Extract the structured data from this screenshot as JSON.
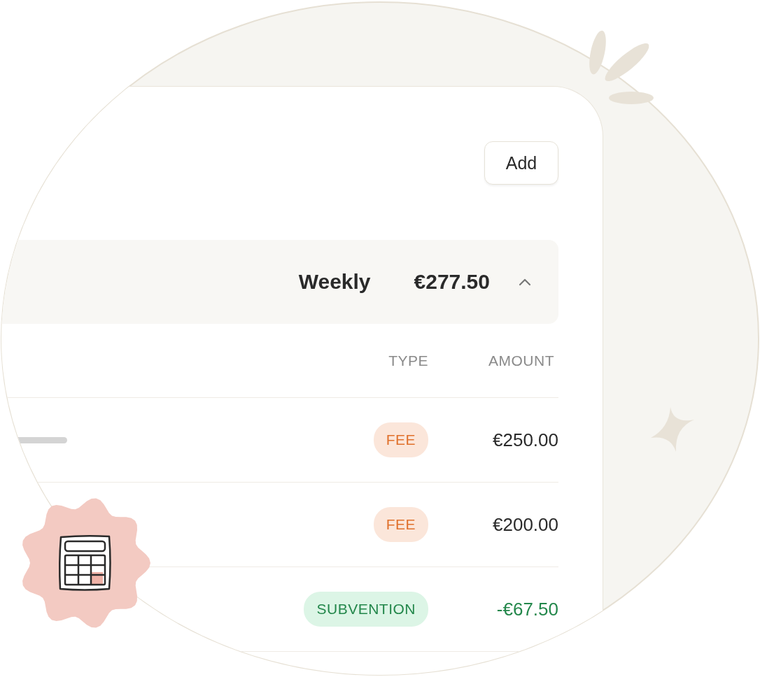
{
  "toolbar": {
    "add_button": "Add"
  },
  "summary": {
    "period": "Weekly",
    "total": "€277.50",
    "expanded": true
  },
  "table": {
    "columns": [
      "TYPE",
      "AMOUNT"
    ],
    "rows": [
      {
        "kind": "fee",
        "type": "FEE",
        "amount": "€250.00"
      },
      {
        "kind": "fee",
        "type": "FEE",
        "amount": "€200.00"
      },
      {
        "kind": "subvention",
        "type": "SUBVENTION",
        "amount": "-€67.50"
      }
    ]
  }
}
